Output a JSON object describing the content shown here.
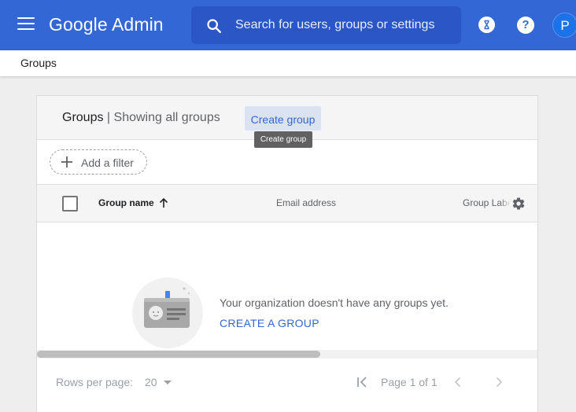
{
  "header": {
    "brand": "Google Admin",
    "search_placeholder": "Search for users, groups or settings",
    "avatar_initial": "P",
    "help_label": "?",
    "colors": {
      "bar": "#3367d6",
      "search": "#2a56c6"
    }
  },
  "breadcrumb": {
    "current": "Groups"
  },
  "card": {
    "title": "Groups",
    "separator": "|",
    "subtitle": "Showing all groups",
    "create_button": "Create group",
    "tooltip": "Create group",
    "add_filter": "Add a filter"
  },
  "table": {
    "columns": {
      "name": "Group name",
      "email": "Email address",
      "labels": "Group Labels"
    },
    "sort": "ascending",
    "empty_message": "Your organization doesn't have any groups yet.",
    "empty_action": "CREATE A GROUP"
  },
  "footer": {
    "rows_per_page_label": "Rows per page:",
    "rows_per_page_value": "20",
    "page_info": "Page 1 of 1"
  },
  "icons": [
    "menu-icon",
    "search-icon",
    "hourglass-icon",
    "help-icon",
    "plus-icon",
    "arrow-up-icon",
    "gear-icon",
    "group-card-icon",
    "first-page-icon",
    "chevron-left-icon",
    "chevron-right-icon"
  ]
}
